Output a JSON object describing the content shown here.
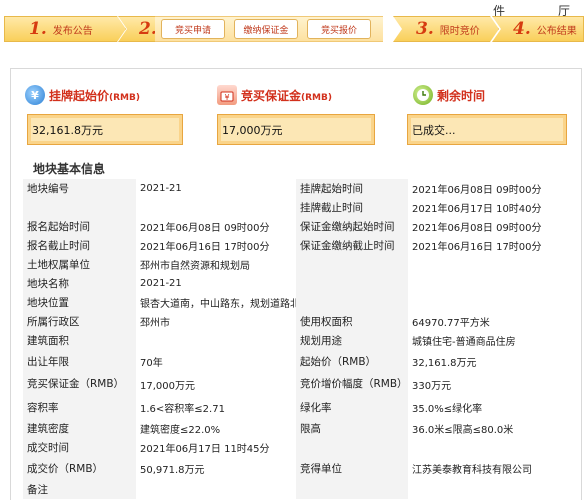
{
  "corner": {
    "left_char": "件",
    "right_char": "厅"
  },
  "steps": [
    {
      "num": "1.",
      "label": "发布公告"
    },
    {
      "num": "2.",
      "label": "竞买申请"
    },
    {
      "num": "3.",
      "label": "限时竞价"
    },
    {
      "num": "4.",
      "label": "公布结果"
    }
  ],
  "substeps": [
    "竞买申请",
    "缴纳保证金",
    "竞买报价"
  ],
  "metrics": {
    "start_price": {
      "title": "挂牌起始价",
      "unit": "(RMB)",
      "value": "32,161.8万元",
      "icon": "money-bag-icon"
    },
    "deposit": {
      "title": "竞买保证金",
      "unit": "(RMB)",
      "value": "17,000万元",
      "icon": "deposit-icon"
    },
    "remaining": {
      "title": "剩余时间",
      "value": "已成交...",
      "icon": "clock-icon"
    }
  },
  "section_title": "地块基本信息",
  "rows": [
    [
      "地块编号",
      "2021-21",
      "挂牌起始时间",
      "2021年06月08日 09时00分"
    ],
    [
      "",
      "",
      "挂牌截止时间",
      "2021年06月17日 10时40分"
    ],
    [
      "报名起始时间",
      "2021年06月08日 09时00分",
      "保证金缴纳起始时间",
      "2021年06月08日 09时00分"
    ],
    [
      "报名截止时间",
      "2021年06月16日 17时00分",
      "保证金缴纳截止时间",
      "2021年06月16日 17时00分"
    ],
    [
      "土地权属单位",
      "邳州市自然资源和规划局",
      "",
      ""
    ],
    [
      "地块名称",
      "2021-21",
      "",
      ""
    ],
    [
      "地块位置",
      "银杏大道南，中山路东，规划道路北",
      "",
      ""
    ],
    [
      "所属行政区",
      "邳州市",
      "使用权面积",
      "64970.77平方米"
    ],
    [
      "建筑面积",
      "",
      "规划用途",
      "城镇住宅-普通商品住房"
    ],
    [
      "出让年限",
      "70年",
      "起始价（RMB）",
      "32,161.8万元"
    ],
    [
      "竞买保证金（RMB）",
      "17,000万元",
      "竞价增价幅度（RMB）",
      "330万元"
    ],
    [
      "容积率",
      "1.6<容积率≤2.71",
      "绿化率",
      "35.0%≤绿化率"
    ],
    [
      "建筑密度",
      "建筑密度≤22.0%",
      "限高",
      "36.0米≤限高≤80.0米"
    ],
    [
      "成交时间",
      "2021年06月17日 11时45分",
      "",
      ""
    ],
    [
      "成交价（RMB）",
      "50,971.8万元",
      "竞得单位",
      "江苏美泰教育科技有限公司"
    ],
    [
      "备注",
      "",
      "",
      ""
    ]
  ],
  "colors": {
    "accent": "#d2301c",
    "box_fill": "#fce7b5",
    "box_border": "#e8a640",
    "key_bg": "#f3f3f3"
  }
}
